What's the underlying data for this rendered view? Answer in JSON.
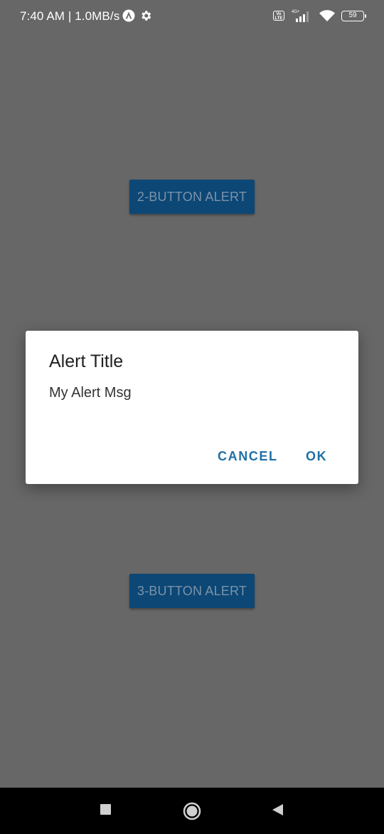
{
  "status_bar": {
    "time_text": "7:40 AM | 1.0MB/s",
    "network_type": "4G+",
    "volte_label": "Vo LTE",
    "battery_level": "59"
  },
  "buttons": {
    "two_button_label": "2-BUTTON ALERT",
    "three_button_label": "3-BUTTON ALERT"
  },
  "dialog": {
    "title": "Alert Title",
    "message": "My Alert Msg",
    "cancel_label": "CANCEL",
    "ok_label": "OK"
  },
  "colors": {
    "scrim": "#676767",
    "button_bg": "#0c4776",
    "dialog_action": "#1f6fa5"
  }
}
